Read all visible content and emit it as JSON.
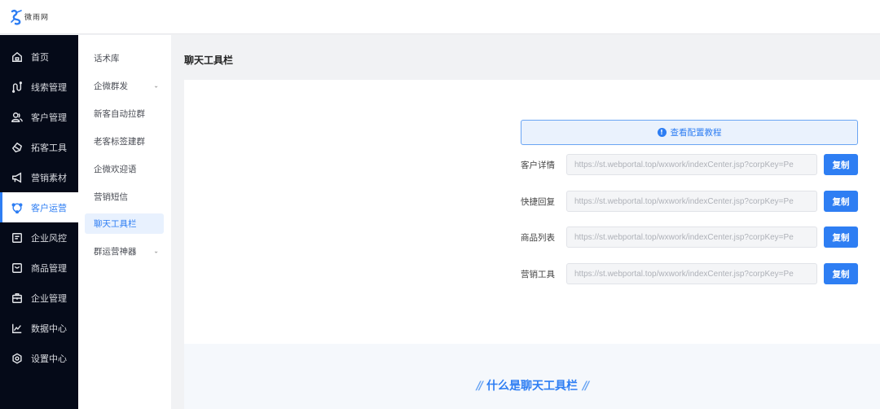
{
  "brand": {
    "name": "微雨网",
    "color": "#2e7ef3"
  },
  "sidebar": {
    "items": [
      {
        "label": "首页",
        "icon": "home-icon",
        "active": false
      },
      {
        "label": "线索管理",
        "icon": "leads-icon",
        "active": false
      },
      {
        "label": "客户管理",
        "icon": "users-icon",
        "active": false
      },
      {
        "label": "拓客工具",
        "icon": "handshake-icon",
        "active": false
      },
      {
        "label": "营销素材",
        "icon": "megaphone-icon",
        "active": false
      },
      {
        "label": "客户运营",
        "icon": "operation-icon",
        "active": true
      },
      {
        "label": "企业风控",
        "icon": "risk-icon",
        "active": false
      },
      {
        "label": "商品管理",
        "icon": "bag-icon",
        "active": false
      },
      {
        "label": "企业管理",
        "icon": "briefcase-icon",
        "active": false
      },
      {
        "label": "数据中心",
        "icon": "chart-icon",
        "active": false
      },
      {
        "label": "设置中心",
        "icon": "settings-icon",
        "active": false
      }
    ]
  },
  "submenu": {
    "items": [
      {
        "label": "话术库",
        "has_children": false,
        "active": false
      },
      {
        "label": "企微群发",
        "has_children": true,
        "active": false
      },
      {
        "label": "新客自动拉群",
        "has_children": false,
        "active": false
      },
      {
        "label": "老客标签建群",
        "has_children": false,
        "active": false
      },
      {
        "label": "企微欢迎语",
        "has_children": false,
        "active": false
      },
      {
        "label": "营销短信",
        "has_children": false,
        "active": false
      },
      {
        "label": "聊天工具栏",
        "has_children": false,
        "active": true
      },
      {
        "label": "群运营神器",
        "has_children": true,
        "active": false
      }
    ],
    "caret": "⌄"
  },
  "main": {
    "title": "聊天工具栏",
    "tutorial": {
      "label": "查看配置教程",
      "icon": "!"
    },
    "rows": [
      {
        "label": "客户详情",
        "url": "https://st.webportal.top/wxwork/indexCenter.jsp?corpKey=Pe",
        "button": "复制"
      },
      {
        "label": "快捷回复",
        "url": "https://st.webportal.top/wxwork/indexCenter.jsp?corpKey=Pe",
        "button": "复制"
      },
      {
        "label": "商品列表",
        "url": "https://st.webportal.top/wxwork/indexCenter.jsp?corpKey=Pe",
        "button": "复制"
      },
      {
        "label": "营销工具",
        "url": "https://st.webportal.top/wxwork/indexCenter.jsp?corpKey=Pe",
        "button": "复制"
      }
    ],
    "intro": {
      "title": "什么是聊天工具栏",
      "deco": "//"
    }
  }
}
